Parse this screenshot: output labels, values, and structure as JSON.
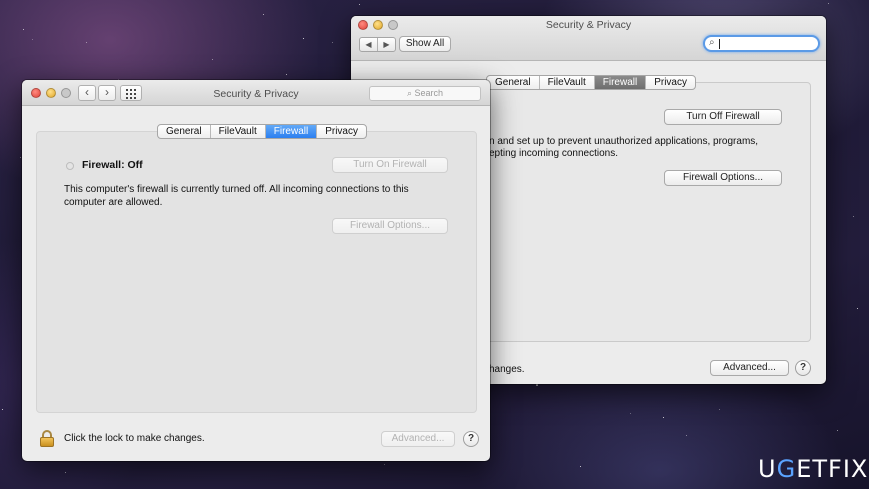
{
  "back_window": {
    "title": "Security & Privacy",
    "show_all_label": "Show All",
    "nav_back_glyph": "◀",
    "nav_forward_glyph": "▶",
    "search_icon": "magnifier-icon",
    "tabs": [
      "General",
      "FileVault",
      "Firewall",
      "Privacy"
    ],
    "selected_tab": "Firewall",
    "turn_off_label": "Turn Off Firewall",
    "desc_line1": "n and set up to prevent unauthorized applications, programs,",
    "desc_line2": "epting incoming connections.",
    "options_label": "Firewall Options...",
    "footer_text": "hanges.",
    "advanced_label": "Advanced...",
    "help_label": "?"
  },
  "front_window": {
    "title": "Security & Privacy",
    "nav_back_glyph": "‹",
    "nav_forward_glyph": "›",
    "search_placeholder": "Search",
    "search_icon_glyph": "⌕",
    "tabs": [
      "General",
      "FileVault",
      "Firewall",
      "Privacy"
    ],
    "selected_tab": "Firewall",
    "firewall_status": "Firewall: Off",
    "turn_on_label": "Turn On Firewall",
    "description": "This computer's firewall is currently turned off. All incoming connections to this computer are allowed.",
    "options_label": "Firewall Options...",
    "lock_label": "Click the lock to make changes.",
    "advanced_label": "Advanced...",
    "help_label": "?"
  },
  "watermark": {
    "part1": "U",
    "part2": "G",
    "part3": "ETFIX"
  },
  "colors": {
    "selected_tab_front": "#2c7ff0",
    "selected_tab_back": "#6e6e6e",
    "search_focus": "#5b9ae6"
  }
}
